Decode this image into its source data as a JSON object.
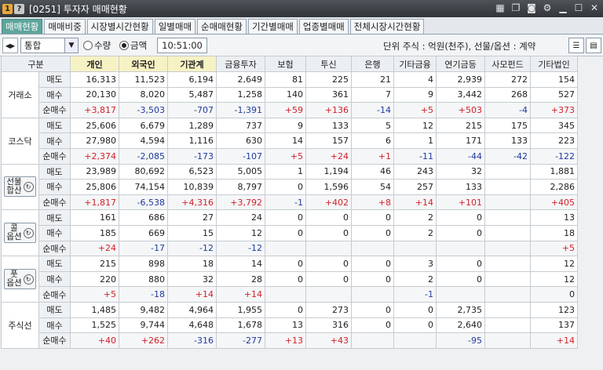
{
  "window": {
    "title": "[0251] 투자자 매매현황",
    "badge_one": "1",
    "badge_help": "?"
  },
  "tabs": [
    "매매현황",
    "매매비중",
    "시장별시간현황",
    "일별매매",
    "순매매현황",
    "기간별매매",
    "업종별매매",
    "전체시장시간현황"
  ],
  "toolbar": {
    "market_value": "통합",
    "radio_qty": "수량",
    "radio_amount": "금액",
    "time": "10:51:00",
    "unit_text": "단위 주식 : 억원(천주), 선물/옵션 : 계약"
  },
  "columns": [
    "구분",
    "",
    "개인",
    "외국인",
    "기관계",
    "금융투자",
    "보험",
    "투신",
    "은행",
    "기타금융",
    "연기금등",
    "사모펀드",
    "기타법인"
  ],
  "row_labels": [
    "매도",
    "매수",
    "순매수"
  ],
  "groups": [
    {
      "name": "거래소",
      "rows": [
        [
          "16,313",
          "11,523",
          "6,194",
          "2,649",
          "81",
          "225",
          "21",
          "4",
          "2,939",
          "272",
          "154"
        ],
        [
          "20,130",
          "8,020",
          "5,487",
          "1,258",
          "140",
          "361",
          "7",
          "9",
          "3,442",
          "268",
          "527"
        ],
        [
          "+3,817",
          "-3,503",
          "-707",
          "-1,391",
          "+59",
          "+136",
          "-14",
          "+5",
          "+503",
          "-4",
          "+373"
        ]
      ]
    },
    {
      "name": "코스닥",
      "rows": [
        [
          "25,606",
          "6,679",
          "1,289",
          "737",
          "9",
          "133",
          "5",
          "12",
          "215",
          "175",
          "345"
        ],
        [
          "27,980",
          "4,594",
          "1,116",
          "630",
          "14",
          "157",
          "6",
          "1",
          "171",
          "133",
          "223"
        ],
        [
          "+2,374",
          "-2,085",
          "-173",
          "-107",
          "+5",
          "+24",
          "+1",
          "-11",
          "-44",
          "-42",
          "-122"
        ]
      ]
    },
    {
      "name": "선물\n합산",
      "button": true,
      "rows": [
        [
          "23,989",
          "80,692",
          "6,523",
          "5,005",
          "1",
          "1,194",
          "46",
          "243",
          "32",
          "",
          "1,881"
        ],
        [
          "25,806",
          "74,154",
          "10,839",
          "8,797",
          "0",
          "1,596",
          "54",
          "257",
          "133",
          "",
          "2,286"
        ],
        [
          "+1,817",
          "-6,538",
          "+4,316",
          "+3,792",
          "-1",
          "+402",
          "+8",
          "+14",
          "+101",
          "",
          "+405"
        ]
      ]
    },
    {
      "name": "콜\n옵션",
      "button": true,
      "rows": [
        [
          "161",
          "686",
          "27",
          "24",
          "0",
          "0",
          "0",
          "2",
          "0",
          "",
          "13"
        ],
        [
          "185",
          "669",
          "15",
          "12",
          "0",
          "0",
          "0",
          "2",
          "0",
          "",
          "18"
        ],
        [
          "+24",
          "-17",
          "-12",
          "-12",
          "",
          "",
          "",
          "",
          "",
          "",
          "+5"
        ]
      ]
    },
    {
      "name": "풋\n옵션",
      "button": true,
      "rows": [
        [
          "215",
          "898",
          "18",
          "14",
          "0",
          "0",
          "0",
          "3",
          "0",
          "",
          "12"
        ],
        [
          "220",
          "880",
          "32",
          "28",
          "0",
          "0",
          "0",
          "2",
          "0",
          "",
          "12"
        ],
        [
          "+5",
          "-18",
          "+14",
          "+14",
          "",
          "",
          "",
          "-1",
          "",
          "",
          "0"
        ]
      ]
    },
    {
      "name": "주식선",
      "rows": [
        [
          "1,485",
          "9,482",
          "4,964",
          "1,955",
          "0",
          "273",
          "0",
          "0",
          "2,735",
          "",
          "123"
        ],
        [
          "1,525",
          "9,744",
          "4,648",
          "1,678",
          "13",
          "316",
          "0",
          "0",
          "2,640",
          "",
          "137"
        ],
        [
          "+40",
          "+262",
          "-316",
          "-277",
          "+13",
          "+43",
          "",
          "",
          "-95",
          "",
          "+14"
        ]
      ]
    }
  ]
}
